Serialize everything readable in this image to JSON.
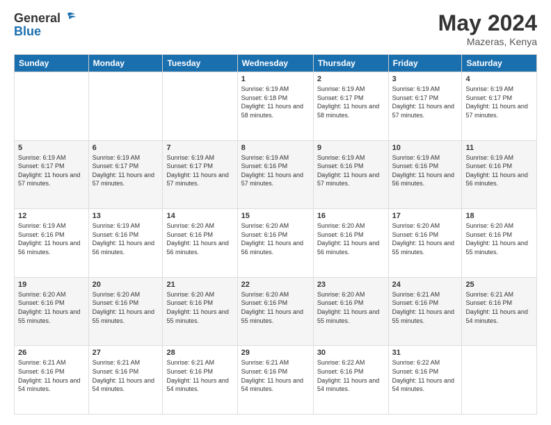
{
  "header": {
    "logo_line1": "General",
    "logo_line2": "Blue",
    "month": "May 2024",
    "location": "Mazeras, Kenya"
  },
  "weekdays": [
    "Sunday",
    "Monday",
    "Tuesday",
    "Wednesday",
    "Thursday",
    "Friday",
    "Saturday"
  ],
  "weeks": [
    [
      {
        "day": "",
        "sunrise": "",
        "sunset": "",
        "daylight": ""
      },
      {
        "day": "",
        "sunrise": "",
        "sunset": "",
        "daylight": ""
      },
      {
        "day": "",
        "sunrise": "",
        "sunset": "",
        "daylight": ""
      },
      {
        "day": "1",
        "sunrise": "Sunrise: 6:19 AM",
        "sunset": "Sunset: 6:18 PM",
        "daylight": "Daylight: 11 hours and 58 minutes."
      },
      {
        "day": "2",
        "sunrise": "Sunrise: 6:19 AM",
        "sunset": "Sunset: 6:17 PM",
        "daylight": "Daylight: 11 hours and 58 minutes."
      },
      {
        "day": "3",
        "sunrise": "Sunrise: 6:19 AM",
        "sunset": "Sunset: 6:17 PM",
        "daylight": "Daylight: 11 hours and 57 minutes."
      },
      {
        "day": "4",
        "sunrise": "Sunrise: 6:19 AM",
        "sunset": "Sunset: 6:17 PM",
        "daylight": "Daylight: 11 hours and 57 minutes."
      }
    ],
    [
      {
        "day": "5",
        "sunrise": "Sunrise: 6:19 AM",
        "sunset": "Sunset: 6:17 PM",
        "daylight": "Daylight: 11 hours and 57 minutes."
      },
      {
        "day": "6",
        "sunrise": "Sunrise: 6:19 AM",
        "sunset": "Sunset: 6:17 PM",
        "daylight": "Daylight: 11 hours and 57 minutes."
      },
      {
        "day": "7",
        "sunrise": "Sunrise: 6:19 AM",
        "sunset": "Sunset: 6:17 PM",
        "daylight": "Daylight: 11 hours and 57 minutes."
      },
      {
        "day": "8",
        "sunrise": "Sunrise: 6:19 AM",
        "sunset": "Sunset: 6:16 PM",
        "daylight": "Daylight: 11 hours and 57 minutes."
      },
      {
        "day": "9",
        "sunrise": "Sunrise: 6:19 AM",
        "sunset": "Sunset: 6:16 PM",
        "daylight": "Daylight: 11 hours and 57 minutes."
      },
      {
        "day": "10",
        "sunrise": "Sunrise: 6:19 AM",
        "sunset": "Sunset: 6:16 PM",
        "daylight": "Daylight: 11 hours and 56 minutes."
      },
      {
        "day": "11",
        "sunrise": "Sunrise: 6:19 AM",
        "sunset": "Sunset: 6:16 PM",
        "daylight": "Daylight: 11 hours and 56 minutes."
      }
    ],
    [
      {
        "day": "12",
        "sunrise": "Sunrise: 6:19 AM",
        "sunset": "Sunset: 6:16 PM",
        "daylight": "Daylight: 11 hours and 56 minutes."
      },
      {
        "day": "13",
        "sunrise": "Sunrise: 6:19 AM",
        "sunset": "Sunset: 6:16 PM",
        "daylight": "Daylight: 11 hours and 56 minutes."
      },
      {
        "day": "14",
        "sunrise": "Sunrise: 6:20 AM",
        "sunset": "Sunset: 6:16 PM",
        "daylight": "Daylight: 11 hours and 56 minutes."
      },
      {
        "day": "15",
        "sunrise": "Sunrise: 6:20 AM",
        "sunset": "Sunset: 6:16 PM",
        "daylight": "Daylight: 11 hours and 56 minutes."
      },
      {
        "day": "16",
        "sunrise": "Sunrise: 6:20 AM",
        "sunset": "Sunset: 6:16 PM",
        "daylight": "Daylight: 11 hours and 56 minutes."
      },
      {
        "day": "17",
        "sunrise": "Sunrise: 6:20 AM",
        "sunset": "Sunset: 6:16 PM",
        "daylight": "Daylight: 11 hours and 55 minutes."
      },
      {
        "day": "18",
        "sunrise": "Sunrise: 6:20 AM",
        "sunset": "Sunset: 6:16 PM",
        "daylight": "Daylight: 11 hours and 55 minutes."
      }
    ],
    [
      {
        "day": "19",
        "sunrise": "Sunrise: 6:20 AM",
        "sunset": "Sunset: 6:16 PM",
        "daylight": "Daylight: 11 hours and 55 minutes."
      },
      {
        "day": "20",
        "sunrise": "Sunrise: 6:20 AM",
        "sunset": "Sunset: 6:16 PM",
        "daylight": "Daylight: 11 hours and 55 minutes."
      },
      {
        "day": "21",
        "sunrise": "Sunrise: 6:20 AM",
        "sunset": "Sunset: 6:16 PM",
        "daylight": "Daylight: 11 hours and 55 minutes."
      },
      {
        "day": "22",
        "sunrise": "Sunrise: 6:20 AM",
        "sunset": "Sunset: 6:16 PM",
        "daylight": "Daylight: 11 hours and 55 minutes."
      },
      {
        "day": "23",
        "sunrise": "Sunrise: 6:20 AM",
        "sunset": "Sunset: 6:16 PM",
        "daylight": "Daylight: 11 hours and 55 minutes."
      },
      {
        "day": "24",
        "sunrise": "Sunrise: 6:21 AM",
        "sunset": "Sunset: 6:16 PM",
        "daylight": "Daylight: 11 hours and 55 minutes."
      },
      {
        "day": "25",
        "sunrise": "Sunrise: 6:21 AM",
        "sunset": "Sunset: 6:16 PM",
        "daylight": "Daylight: 11 hours and 54 minutes."
      }
    ],
    [
      {
        "day": "26",
        "sunrise": "Sunrise: 6:21 AM",
        "sunset": "Sunset: 6:16 PM",
        "daylight": "Daylight: 11 hours and 54 minutes."
      },
      {
        "day": "27",
        "sunrise": "Sunrise: 6:21 AM",
        "sunset": "Sunset: 6:16 PM",
        "daylight": "Daylight: 11 hours and 54 minutes."
      },
      {
        "day": "28",
        "sunrise": "Sunrise: 6:21 AM",
        "sunset": "Sunset: 6:16 PM",
        "daylight": "Daylight: 11 hours and 54 minutes."
      },
      {
        "day": "29",
        "sunrise": "Sunrise: 6:21 AM",
        "sunset": "Sunset: 6:16 PM",
        "daylight": "Daylight: 11 hours and 54 minutes."
      },
      {
        "day": "30",
        "sunrise": "Sunrise: 6:22 AM",
        "sunset": "Sunset: 6:16 PM",
        "daylight": "Daylight: 11 hours and 54 minutes."
      },
      {
        "day": "31",
        "sunrise": "Sunrise: 6:22 AM",
        "sunset": "Sunset: 6:16 PM",
        "daylight": "Daylight: 11 hours and 54 minutes."
      },
      {
        "day": "",
        "sunrise": "",
        "sunset": "",
        "daylight": ""
      }
    ]
  ]
}
